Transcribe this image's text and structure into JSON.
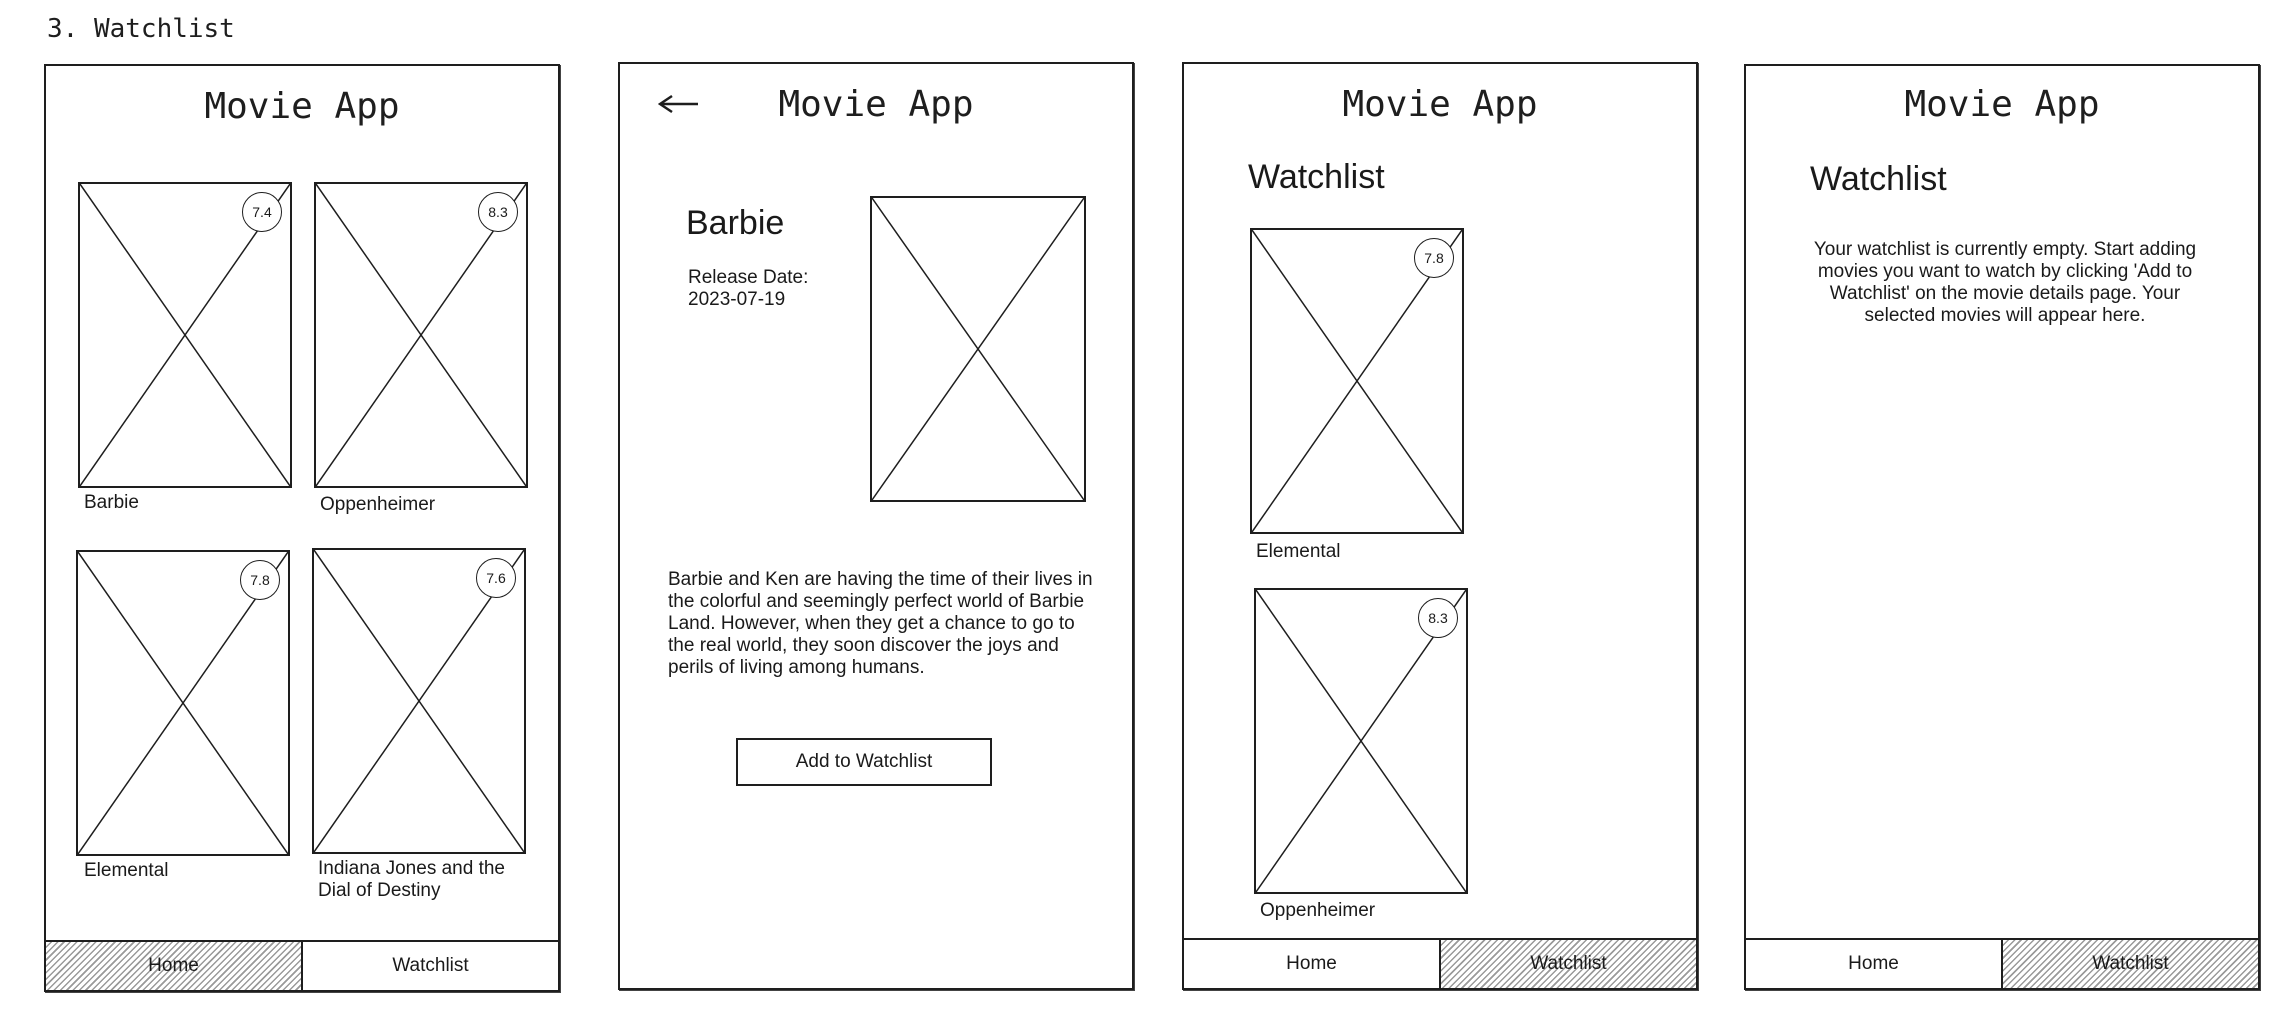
{
  "section_title": "3. Watchlist",
  "screens": {
    "home": {
      "title": "Movie App",
      "movies": [
        {
          "title": "Barbie",
          "rating": "7.4"
        },
        {
          "title": "Oppenheimer",
          "rating": "8.3"
        },
        {
          "title": "Elemental",
          "rating": "7.8"
        },
        {
          "title": "Indiana Jones and the Dial of Destiny",
          "rating": "7.6"
        }
      ],
      "nav": {
        "home": "Home",
        "watchlist": "Watchlist",
        "active": "home"
      }
    },
    "details": {
      "title": "Movie App",
      "back_icon": "arrow-left-icon",
      "movie_title": "Barbie",
      "release_label": "Release Date:",
      "release_date": "2023-07-19",
      "description": "Barbie and Ken are having the time of their lives in the colorful and seemingly perfect world of Barbie Land. However, when they get a chance to go to the real world, they soon discover the joys and perils of living among humans.",
      "add_button": "Add to Watchlist"
    },
    "watchlist": {
      "title": "Movie App",
      "heading": "Watchlist",
      "movies": [
        {
          "title": "Elemental",
          "rating": "7.8"
        },
        {
          "title": "Oppenheimer",
          "rating": "8.3"
        }
      ],
      "nav": {
        "home": "Home",
        "watchlist": "Watchlist",
        "active": "watchlist"
      }
    },
    "empty_watchlist": {
      "title": "Movie App",
      "heading": "Watchlist",
      "empty_message": "Your watchlist is currently empty. Start adding movies you want to watch by clicking 'Add to Watchlist' on the movie details page. Your selected movies will appear here.",
      "nav": {
        "home": "Home",
        "watchlist": "Watchlist",
        "active": "watchlist"
      }
    }
  }
}
